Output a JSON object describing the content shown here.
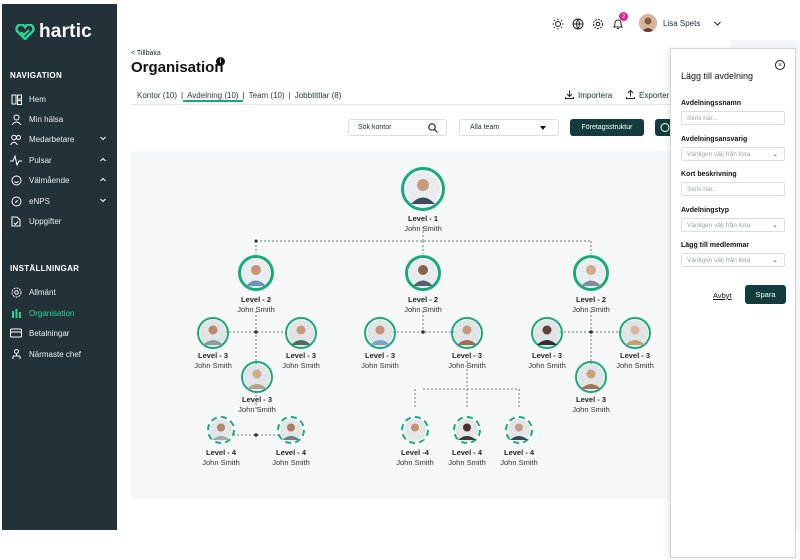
{
  "brand": {
    "name": "hartic",
    "accent": "#2fd39a",
    "dark": "#233238",
    "button": "#133d3d"
  },
  "sidebar": {
    "nav_heading": "NAVIGATION",
    "nav_items": [
      {
        "label": "Hem",
        "icon": "dashboard-icon"
      },
      {
        "label": "Min hälsa",
        "icon": "user-icon"
      },
      {
        "label": "Medarbetare",
        "icon": "users-icon"
      },
      {
        "label": "Pulsar",
        "icon": "pulse-icon"
      },
      {
        "label": "Välmående",
        "icon": "smile-icon"
      },
      {
        "label": "eNPS",
        "icon": "compass-icon"
      },
      {
        "label": "Uppgifter",
        "icon": "document-icon"
      }
    ],
    "settings_heading": "INSTÄLLNINGAR",
    "settings_items": [
      {
        "label": "Allmänt",
        "icon": "gear-icon"
      },
      {
        "label": "Organisation",
        "icon": "organisation-icon"
      },
      {
        "label": "Betalningar",
        "icon": "card-icon"
      },
      {
        "label": "Närmaste chef",
        "icon": "hierarchy-icon"
      }
    ]
  },
  "topbar": {
    "notification_count": "2",
    "user_name": "Lisa Spets"
  },
  "page": {
    "back": "< Tillbaka",
    "title": "Organisation",
    "tabs": [
      {
        "label": "Kontor (10)"
      },
      {
        "label": "Avdelning (10)"
      },
      {
        "label": "Team (10)"
      },
      {
        "label": "Jobbtittlar (8)"
      }
    ],
    "import_label": "Importera",
    "export_label": "Exporter",
    "search_placeholder": "Sök kontor",
    "team_select": "Alla team",
    "structure_button": "Företagsstruktur"
  },
  "org": {
    "level1": {
      "level": "Level - 1",
      "name": "John Smith"
    },
    "level2": {
      "level": "Level - 2",
      "name": "John Smith"
    },
    "level3": {
      "level": "Level - 3",
      "name": "John Smith"
    },
    "level4": {
      "level": "Level - 4",
      "name": "John Smith"
    },
    "level4_alt": {
      "level": "Level -4",
      "name": "John Smith"
    }
  },
  "panel": {
    "title": "Lägg till avdelning",
    "fields": [
      {
        "label": "Avdelningssnamn",
        "placeholder": "Skriv här..."
      },
      {
        "label": "Avdelningsansvarig",
        "placeholder": "Vänligen välj från lista"
      },
      {
        "label": "Kort beskrivning",
        "placeholder": "Skriv här..."
      },
      {
        "label": "Avdelningstyp",
        "placeholder": "Vänligen välj från lista"
      },
      {
        "label": "Lägg till medlemmar",
        "placeholder": "Vänligen välj från lista"
      }
    ],
    "cancel": "Avbyt",
    "save": "Spara"
  }
}
